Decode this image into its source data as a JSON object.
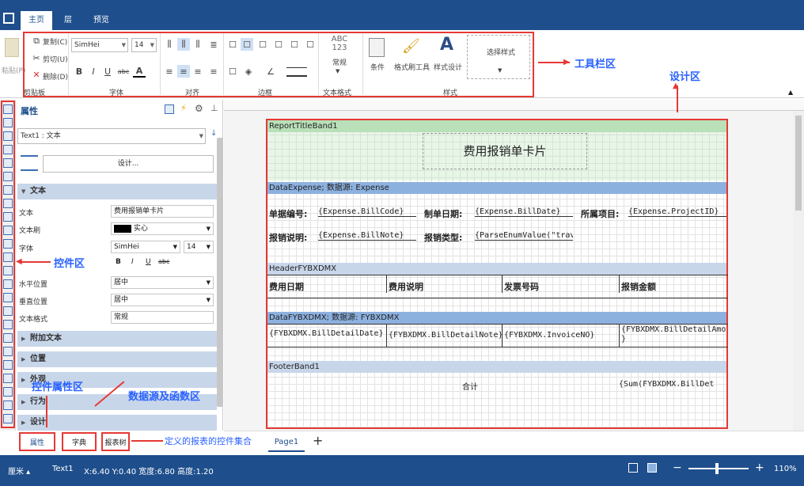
{
  "topbar": {
    "tabs": [
      "主页",
      "层",
      "预览"
    ]
  },
  "ribbon": {
    "paste": "粘贴(P)",
    "clipboard": {
      "copy": "复制(C)",
      "cut": "剪切(U)",
      "delete": "删除(D)",
      "group": "剪贴板"
    },
    "font": {
      "family": "SimHei",
      "size": "14",
      "group": "字体",
      "bold": "B",
      "italic": "I",
      "underline": "U",
      "strike": "abc",
      "color": "A"
    },
    "align": {
      "group": "对齐"
    },
    "border": {
      "group": "边框"
    },
    "textformat": {
      "sample": "ABC\n123",
      "label": "常规",
      "group": "文本格式"
    },
    "style": {
      "condition": "条件",
      "brush": "格式刷工具",
      "design": "样式设计",
      "select": "选择样式",
      "group": "样式"
    }
  },
  "annotations": {
    "toolbar": "工具栏区",
    "design": "设计区",
    "controls": "控件区",
    "properties": "控件属性区",
    "datasource": "数据源及函数区",
    "reporttree": "定义的报表的控件集合"
  },
  "props": {
    "title": "属性",
    "selector": "Text1 : 文本",
    "design_btn": "设计...",
    "sections": {
      "text": "文本",
      "extra": "附加文本",
      "position": "位置",
      "appearance": "外观",
      "behavior": "行为",
      "design": "设计"
    },
    "rows": [
      {
        "label": "文本",
        "value": "费用报销单卡片"
      },
      {
        "label": "文本刷",
        "value": "实心"
      },
      {
        "label": "字体",
        "value": "SimHei",
        "size": "14"
      },
      {
        "label": "水平位置",
        "value": "居中"
      },
      {
        "label": "垂直位置",
        "value": "居中"
      },
      {
        "label": "文本格式",
        "value": "常规"
      }
    ],
    "fontbtns": [
      "B",
      "I",
      "U",
      "abc"
    ]
  },
  "bottomtabs": [
    "属性",
    "字典",
    "报表树"
  ],
  "report": {
    "band1": "ReportTitleBand1",
    "title": "费用报销单卡片",
    "band2": "DataExpense; 数据源: Expense",
    "f_billcode_label": "单据编号:",
    "f_billcode": "{Expense.BillCode}",
    "f_billdate_label": "制单日期:",
    "f_billdate": "{Expense.BillDate}",
    "f_project_label": "所属项目:",
    "f_project": "{Expense.ProjectID}",
    "f_note_label": "报销说明:",
    "f_note": "{Expense.BillNote}",
    "f_type_label": "报销类型:",
    "f_type": "{ParseEnumValue(\"travel/",
    "band3": "HeaderFYBXDMX",
    "headers": [
      "费用日期",
      "费用说明",
      "发票号码",
      "报销金额"
    ],
    "band4": "DataFYBXDMX; 数据源: FYBXDMX",
    "cells": [
      "{FYBXDMX.BillDetailDate}",
      "{FYBXDMX.BillDetailNote}",
      "{FYBXDMX.InvoiceNO}",
      "{FYBXDMX.BillDetailAmount\n}"
    ],
    "band5": "FooterBand1",
    "total_label": "合计",
    "total_value": "{Sum(FYBXDMX.BillDet"
  },
  "pagetab": "Page1",
  "status": {
    "unit": "厘米",
    "control": "Text1",
    "coords": "X:6.40 Y:0.40 宽度:6.80 高度:1.20",
    "zoom": "110%"
  }
}
